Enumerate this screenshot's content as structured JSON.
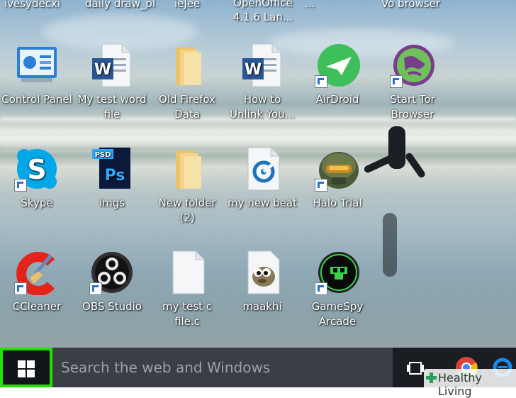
{
  "top_cut_labels": [
    "ivesydecxi",
    "daily draw_pl",
    "ieJee",
    "OpenOffice 4.1.6 Lan...",
    "...",
    "Vo browser"
  ],
  "desktop": {
    "icons": [
      {
        "name": "control-panel-icon",
        "label": "Control Panel",
        "shortcut": false
      },
      {
        "name": "word-document-icon",
        "label": "My test word file",
        "shortcut": false
      },
      {
        "name": "folder-icon",
        "label": "Old Firefox Data",
        "shortcut": false
      },
      {
        "name": "word-document-icon",
        "label": "How to Unlink You...",
        "shortcut": false
      },
      {
        "name": "airdroid-icon",
        "label": "AirDroid",
        "shortcut": true
      },
      {
        "name": "tor-browser-icon",
        "label": "Start Tor Browser",
        "shortcut": true
      },
      {
        "name": "skype-icon",
        "label": "Skype",
        "shortcut": true
      },
      {
        "name": "photoshop-file-icon",
        "label": "imgs",
        "shortcut": false
      },
      {
        "name": "folder-icon",
        "label": "New folder (2)",
        "shortcut": false
      },
      {
        "name": "audio-file-icon",
        "label": "my new beat",
        "shortcut": false
      },
      {
        "name": "halo-trial-icon",
        "label": "Halo Trial",
        "shortcut": true
      },
      {
        "name": "ccleaner-icon",
        "label": "CCleaner",
        "shortcut": true
      },
      {
        "name": "obs-studio-icon",
        "label": "OBS Studio",
        "shortcut": true
      },
      {
        "name": "c-file-icon",
        "label": "my test c file.c",
        "shortcut": false
      },
      {
        "name": "gimp-icon",
        "label": "maakhi",
        "shortcut": false
      },
      {
        "name": "gamespy-icon",
        "label": "GameSpy Arcade",
        "shortcut": true
      }
    ]
  },
  "taskbar": {
    "search_placeholder": "Search the web and Windows",
    "start_highlight_color": "#22e000"
  },
  "watermark": {
    "text": "Healthy Living"
  }
}
